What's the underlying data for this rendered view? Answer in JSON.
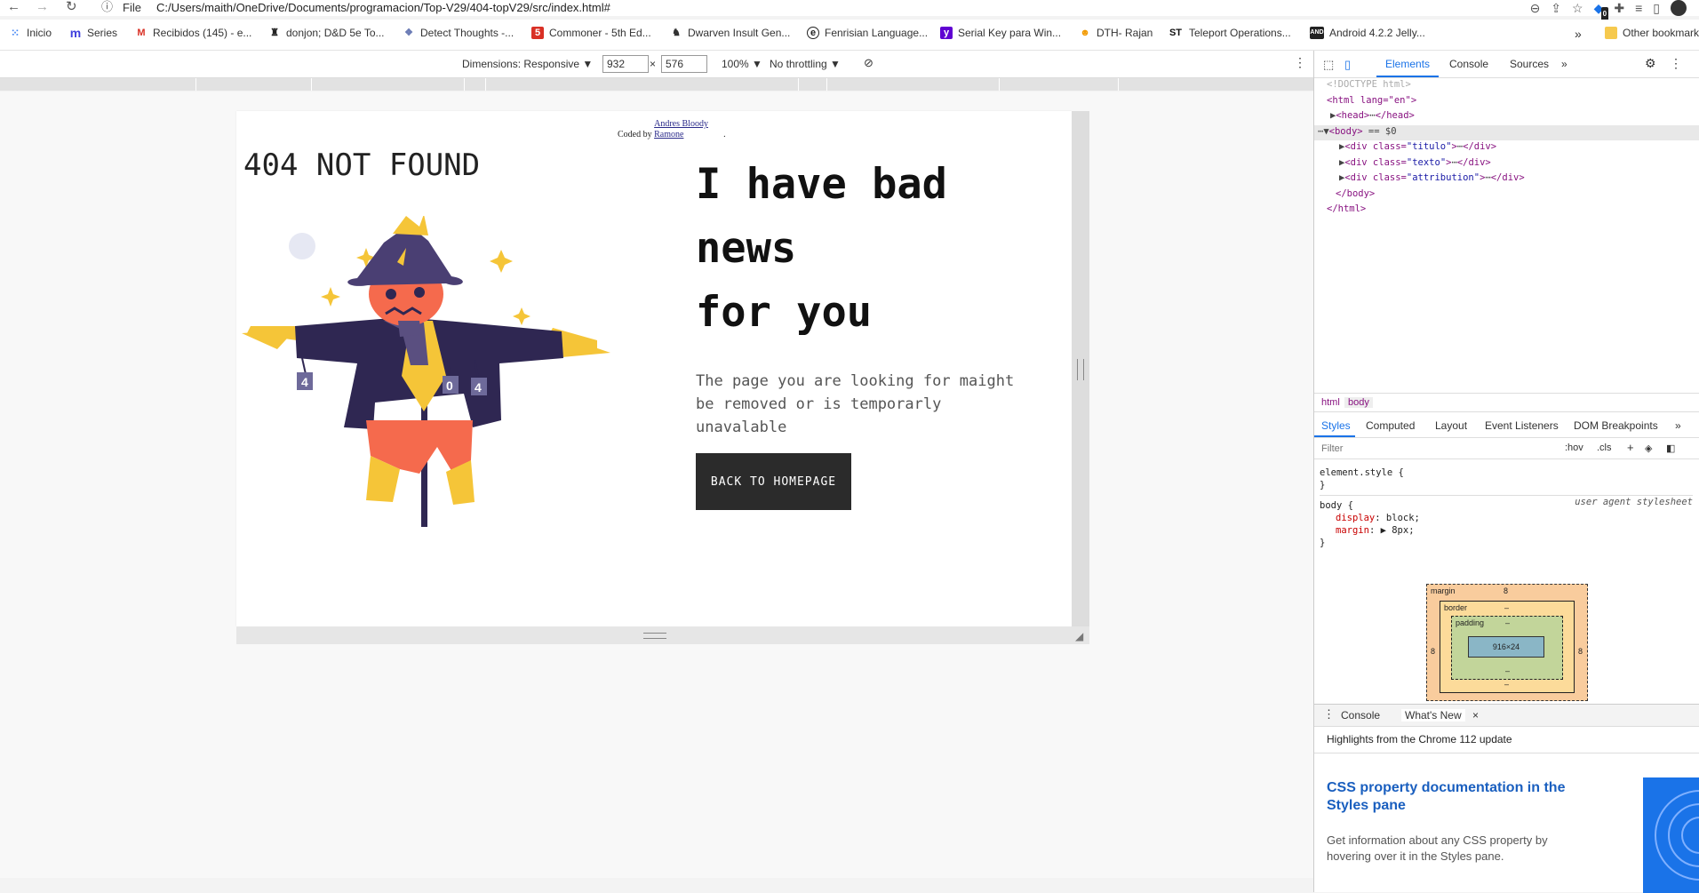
{
  "browser": {
    "file_label": "File",
    "url": "C:/Users/maith/OneDrive/Documents/programacion/Top-V29/404-topV29/src/index.html#",
    "bookmarks": [
      {
        "label": "Inicio",
        "icon": "apps-icon",
        "color": "#4285f4"
      },
      {
        "label": "Series",
        "icon": "m-logo-icon",
        "color": "#3f3fdd"
      },
      {
        "label": "Recibidos (145) - e...",
        "icon": "gmail-icon",
        "color": "#d93025"
      },
      {
        "label": "donjon; D&D 5e To...",
        "icon": "tower-icon",
        "color": "#222222"
      },
      {
        "label": "Detect Thoughts -...",
        "icon": "dnd-icon",
        "color": "#6b7bb5"
      },
      {
        "label": "Commoner - 5th Ed...",
        "icon": "five-icon",
        "color": "#d93025"
      },
      {
        "label": "Dwarven Insult Gen...",
        "icon": "dwarf-icon",
        "color": "#333333"
      },
      {
        "label": "Fenrisian Language...",
        "icon": "e-icon",
        "color": "#222222"
      },
      {
        "label": "Serial Key para Win...",
        "icon": "yahoo-icon",
        "color": "#6001d2"
      },
      {
        "label": "DTH- Rajan",
        "icon": "warrior-icon",
        "color": "#f29900"
      },
      {
        "label": "Teleport Operations...",
        "icon": "st-icon",
        "color": "#111111"
      },
      {
        "label": "Android 4.2.2 Jelly...",
        "icon": "andro-icon",
        "color": "#222222"
      }
    ],
    "overflow": "»",
    "other_bookmarks": "Other bookmarks"
  },
  "device_toolbar": {
    "dimensions": "Dimensions: Responsive ▼",
    "width": "932",
    "times": "×",
    "height": "576",
    "zoom": "100% ▼",
    "throttling": "No throttling ▼"
  },
  "page": {
    "attribution_prefix": "Coded by ",
    "attribution_link": "Andres Bloody Ramone",
    "attribution_suffix": ".",
    "title": "404 NOT FOUND",
    "headline_lines": [
      "I have bad",
      "news",
      "for you"
    ],
    "body_text": "The page you are looking for maight be removed or is temporarly unavalable",
    "button_label": "BACK TO HOMEPAGE"
  },
  "devtools": {
    "tabs": [
      "Elements",
      "Console",
      "Sources",
      "»"
    ],
    "dom": {
      "doctype": "<!DOCTYPE html>",
      "html_open": "<html lang=\"en\">",
      "head": "<head>",
      "head_close": "</head>",
      "body": "<body>",
      "body_marker": "== $0",
      "divs": [
        {
          "class": "titulo"
        },
        {
          "class": "texto"
        },
        {
          "class": "attribution"
        }
      ],
      "div_open": "<div class=",
      "div_close": "</div>",
      "ellipsis": "⋯",
      "body_close": "</body>",
      "html_close": "</html>"
    },
    "breadcrumb": [
      "html",
      "body"
    ],
    "styles_tabs": [
      "Styles",
      "Computed",
      "Layout",
      "Event Listeners",
      "DOM Breakpoints",
      "»"
    ],
    "filter_placeholder": "Filter",
    "hov": ":hov",
    "cls": ".cls",
    "element_style": "element.style {",
    "close_brace": "}",
    "body_rule": {
      "selector": "body {",
      "source": "user agent stylesheet",
      "props": [
        {
          "name": "display",
          "value": "block;"
        },
        {
          "name": "margin",
          "value": "▶ 8px;"
        }
      ]
    },
    "box_model": {
      "margin_label": "margin",
      "margin_value": "8",
      "border_label": "border",
      "dash": "–",
      "padding_label": "padding",
      "content": "916×24",
      "side_value": "8"
    },
    "drawer_tabs": [
      "Console",
      "What's New"
    ],
    "drawer_close": "×",
    "whats_new_heading": "Highlights from the Chrome 112 update",
    "card_title": "CSS property documentation in the Styles pane",
    "card_text": "Get information about any CSS property by hovering over it in the Styles pane."
  },
  "colors": {
    "accent": "#1a73e8",
    "button_bg": "#2b2b2b",
    "scarecrow_hat": "#4a3f73",
    "scarecrow_coat": "#2f2752",
    "scarecrow_face": "#f56a4d",
    "straw": "#f5c538"
  }
}
